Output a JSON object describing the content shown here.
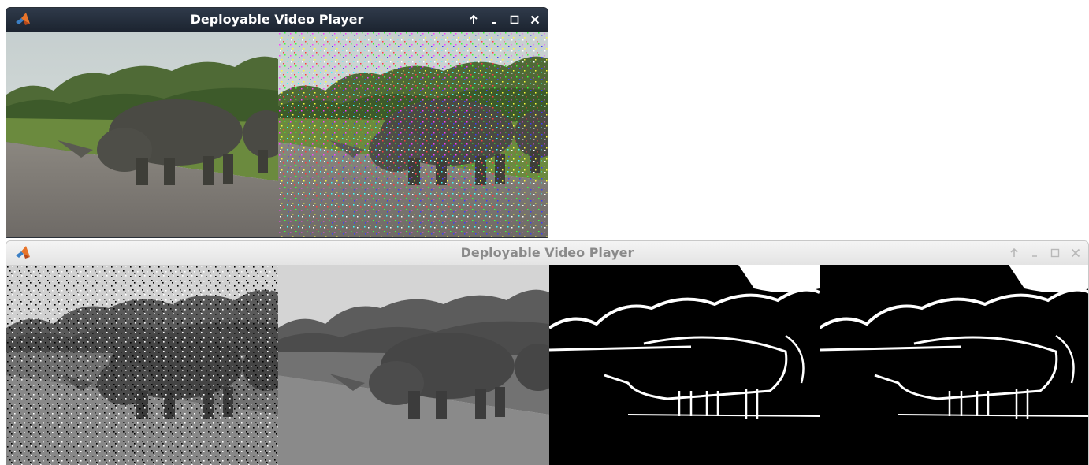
{
  "windows": [
    {
      "title": "Deployable Video Player",
      "state": "active",
      "controls": [
        "up-arrow-icon",
        "minimize-icon",
        "maximize-icon",
        "close-icon"
      ],
      "frames": [
        "original-color-frame",
        "salt-pepper-noise-color-frame"
      ]
    },
    {
      "title": "Deployable Video Player",
      "state": "inactive",
      "controls": [
        "up-arrow-icon",
        "minimize-icon",
        "maximize-icon",
        "close-icon"
      ],
      "frames": [
        "noisy-grayscale-frame",
        "filtered-grayscale-frame",
        "edge-detection-frame-1",
        "edge-detection-frame-2"
      ]
    }
  ],
  "colors": {
    "active_titlebar": "#1c2430",
    "inactive_titlebar": "#e9e9e9",
    "active_title_text": "#ffffff",
    "inactive_title_text": "#8a8a8a",
    "app_icon_orange": "#e8742a",
    "app_icon_blue": "#3b7fc4"
  }
}
